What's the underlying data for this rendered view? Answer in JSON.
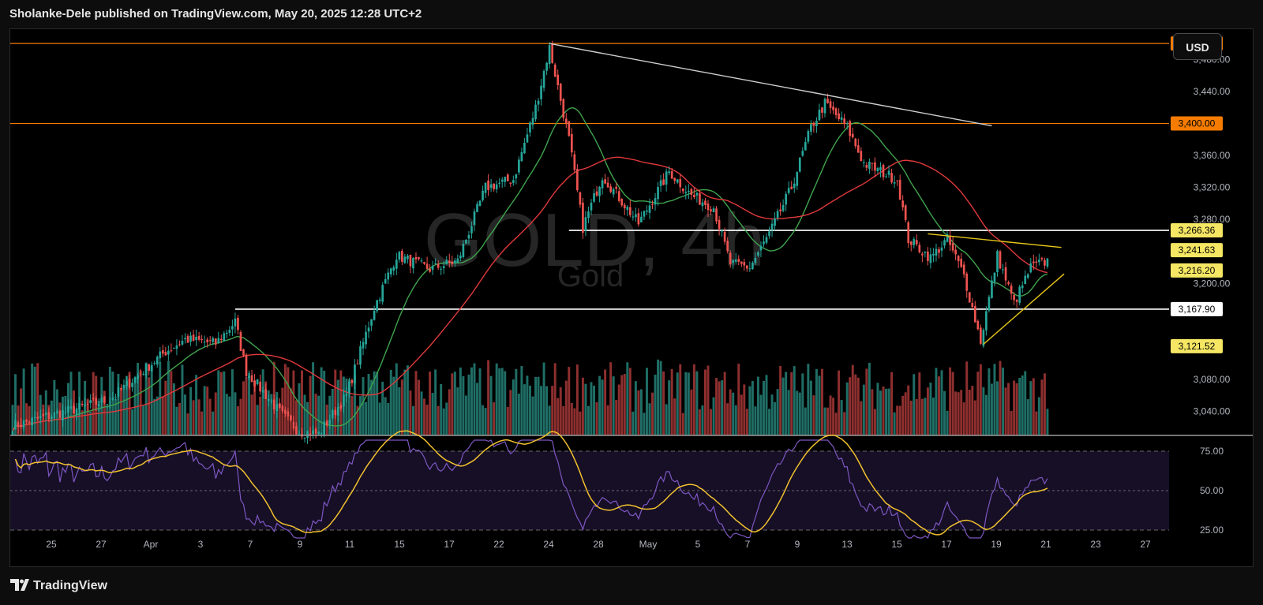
{
  "header": {
    "text": "Sholanke-Dele published on TradingView.com, May 20, 2025 12:28 UTC+2"
  },
  "currency_button": "USD",
  "watermark": {
    "symbol": "GOLD, 4h",
    "name": "Gold"
  },
  "footer": {
    "brand": "TradingView"
  },
  "colors": {
    "up": "#26a69a",
    "down": "#ef5350",
    "vol_up": "#1f6e66",
    "vol_down": "#8e2f2f",
    "ma_fast": "#3fa34d",
    "ma_slow": "#e0393c",
    "resistance": "#f57c00",
    "support": "#ffffff",
    "trend_down": "#cfcfcf",
    "triangle": "#e6c619",
    "rsi": "#7e57c2",
    "rsi_ma": "#f2c12e"
  },
  "chart_data": {
    "type": "candlestick",
    "symbol": "GOLD",
    "interval": "4h",
    "y_axis": {
      "ticks": [
        "3,480.00",
        "3,440.00",
        "3,360.00",
        "3,320.00",
        "3,280.00",
        "3,200.00",
        "3,080.00",
        "3,040.00"
      ],
      "tick_values": [
        3480,
        3440,
        3360,
        3320,
        3280,
        3200,
        3080,
        3040
      ],
      "range": [
        3010,
        3510
      ]
    },
    "x_axis": {
      "labels": [
        "25",
        "27",
        "Apr",
        "3",
        "7",
        "9",
        "11",
        "15",
        "17",
        "22",
        "24",
        "28",
        "May",
        "5",
        "7",
        "9",
        "13",
        "15",
        "17",
        "19",
        "21",
        "23",
        "27"
      ]
    },
    "price_levels": [
      {
        "value": 3500.0,
        "label": "3,500.00",
        "style": "orange"
      },
      {
        "value": 3400.0,
        "label": "3,400.00",
        "style": "orange"
      },
      {
        "value": 3266.36,
        "label": "3,266.36",
        "style": "yellow"
      },
      {
        "value": 3241.63,
        "label": "3,241.63",
        "style": "yellow"
      },
      {
        "value": 3216.2,
        "label": "3,216.20",
        "style": "yellow"
      },
      {
        "value": 3167.9,
        "label": "3,167.90",
        "style": "white"
      },
      {
        "value": 3121.52,
        "label": "3,121.52",
        "style": "yellow"
      }
    ],
    "horizontal_lines": [
      {
        "value": 3500,
        "color": "orange"
      },
      {
        "value": 3400,
        "color": "orange"
      },
      {
        "value": 3266.36,
        "color": "white",
        "from_bar": 200
      },
      {
        "value": 3167.9,
        "color": "white",
        "from_bar": 80
      }
    ],
    "price_path": [
      {
        "bar": 0,
        "price": 3022
      },
      {
        "bar": 35,
        "price": 3055
      },
      {
        "bar": 55,
        "price": 3115
      },
      {
        "bar": 62,
        "price": 3130
      },
      {
        "bar": 73,
        "price": 3125
      },
      {
        "bar": 80,
        "price": 3152
      },
      {
        "bar": 84,
        "price": 3090
      },
      {
        "bar": 97,
        "price": 3035
      },
      {
        "bar": 103,
        "price": 3015
      },
      {
        "bar": 110,
        "price": 3012
      },
      {
        "bar": 120,
        "price": 3060
      },
      {
        "bar": 130,
        "price": 3170
      },
      {
        "bar": 138,
        "price": 3235
      },
      {
        "bar": 150,
        "price": 3218
      },
      {
        "bar": 160,
        "price": 3228
      },
      {
        "bar": 170,
        "price": 3320
      },
      {
        "bar": 180,
        "price": 3330
      },
      {
        "bar": 188,
        "price": 3420
      },
      {
        "bar": 193,
        "price": 3495
      },
      {
        "bar": 200,
        "price": 3380
      },
      {
        "bar": 205,
        "price": 3270
      },
      {
        "bar": 212,
        "price": 3335
      },
      {
        "bar": 225,
        "price": 3275
      },
      {
        "bar": 236,
        "price": 3340
      },
      {
        "bar": 244,
        "price": 3310
      },
      {
        "bar": 252,
        "price": 3295
      },
      {
        "bar": 258,
        "price": 3225
      },
      {
        "bar": 265,
        "price": 3220
      },
      {
        "bar": 272,
        "price": 3262
      },
      {
        "bar": 280,
        "price": 3320
      },
      {
        "bar": 287,
        "price": 3395
      },
      {
        "bar": 292,
        "price": 3425
      },
      {
        "bar": 300,
        "price": 3395
      },
      {
        "bar": 306,
        "price": 3350
      },
      {
        "bar": 318,
        "price": 3330
      },
      {
        "bar": 322,
        "price": 3255
      },
      {
        "bar": 330,
        "price": 3232
      },
      {
        "bar": 336,
        "price": 3255
      },
      {
        "bar": 342,
        "price": 3210
      },
      {
        "bar": 348,
        "price": 3128
      },
      {
        "bar": 354,
        "price": 3235
      },
      {
        "bar": 360,
        "price": 3175
      },
      {
        "bar": 366,
        "price": 3220
      },
      {
        "bar": 372,
        "price": 3228
      }
    ],
    "moving_averages": [
      {
        "name": "MA fast",
        "color": "#3fa34d",
        "period": 20
      },
      {
        "name": "MA slow",
        "color": "#e0393c",
        "period": 50
      }
    ],
    "trendlines": [
      {
        "from": {
          "bar": 193,
          "price": 3500
        },
        "to": {
          "bar": 352,
          "price": 3397
        },
        "color": "#cfcfcf"
      },
      {
        "from": {
          "bar": 329,
          "price": 3262
        },
        "to": {
          "bar": 377,
          "price": 3245
        },
        "color": "#e6c619"
      },
      {
        "from": {
          "bar": 349,
          "price": 3124
        },
        "to": {
          "bar": 378,
          "price": 3212
        },
        "color": "#e6c619"
      }
    ],
    "rsi": {
      "levels": [
        75,
        50,
        25
      ],
      "tick_labels": [
        "75.00",
        "50.00",
        "25.00"
      ],
      "range": [
        20,
        82
      ]
    }
  }
}
